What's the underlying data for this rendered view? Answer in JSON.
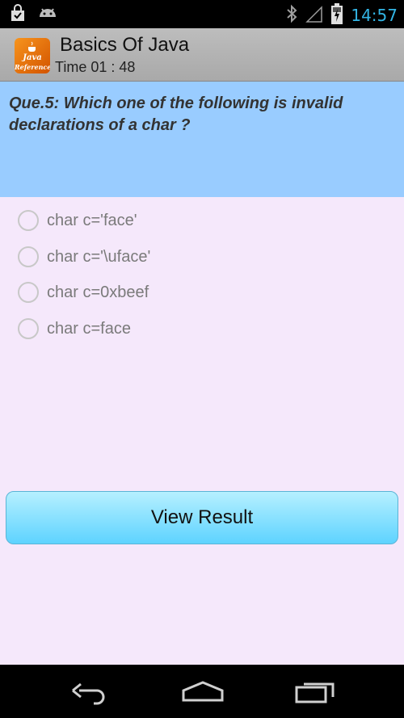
{
  "status_bar": {
    "time": "14:57",
    "left_icons": [
      "shopping-bag-icon",
      "android-icon"
    ],
    "right_icons": [
      "bluetooth-icon",
      "signal-icon",
      "battery-charging-icon"
    ],
    "accent_color": "#33b5e5"
  },
  "action_bar": {
    "app_icon_text_line1": "Java",
    "app_icon_text_line2": "Reference",
    "title": "Basics Of Java",
    "subtitle": "Time 01 : 48"
  },
  "question": {
    "text": "Que.5: Which one of the following is invalid declarations of a char ?",
    "background": "#99ccff"
  },
  "options": [
    {
      "label": "char c='face'",
      "selected": false
    },
    {
      "label": "char c='\\uface'",
      "selected": false
    },
    {
      "label": "char c=0xbeef",
      "selected": false
    },
    {
      "label": "char c=face",
      "selected": false
    }
  ],
  "actions": {
    "view_result_label": "View Result"
  },
  "nav_bar": {
    "buttons": [
      "back-icon",
      "home-icon",
      "recent-apps-icon"
    ]
  }
}
